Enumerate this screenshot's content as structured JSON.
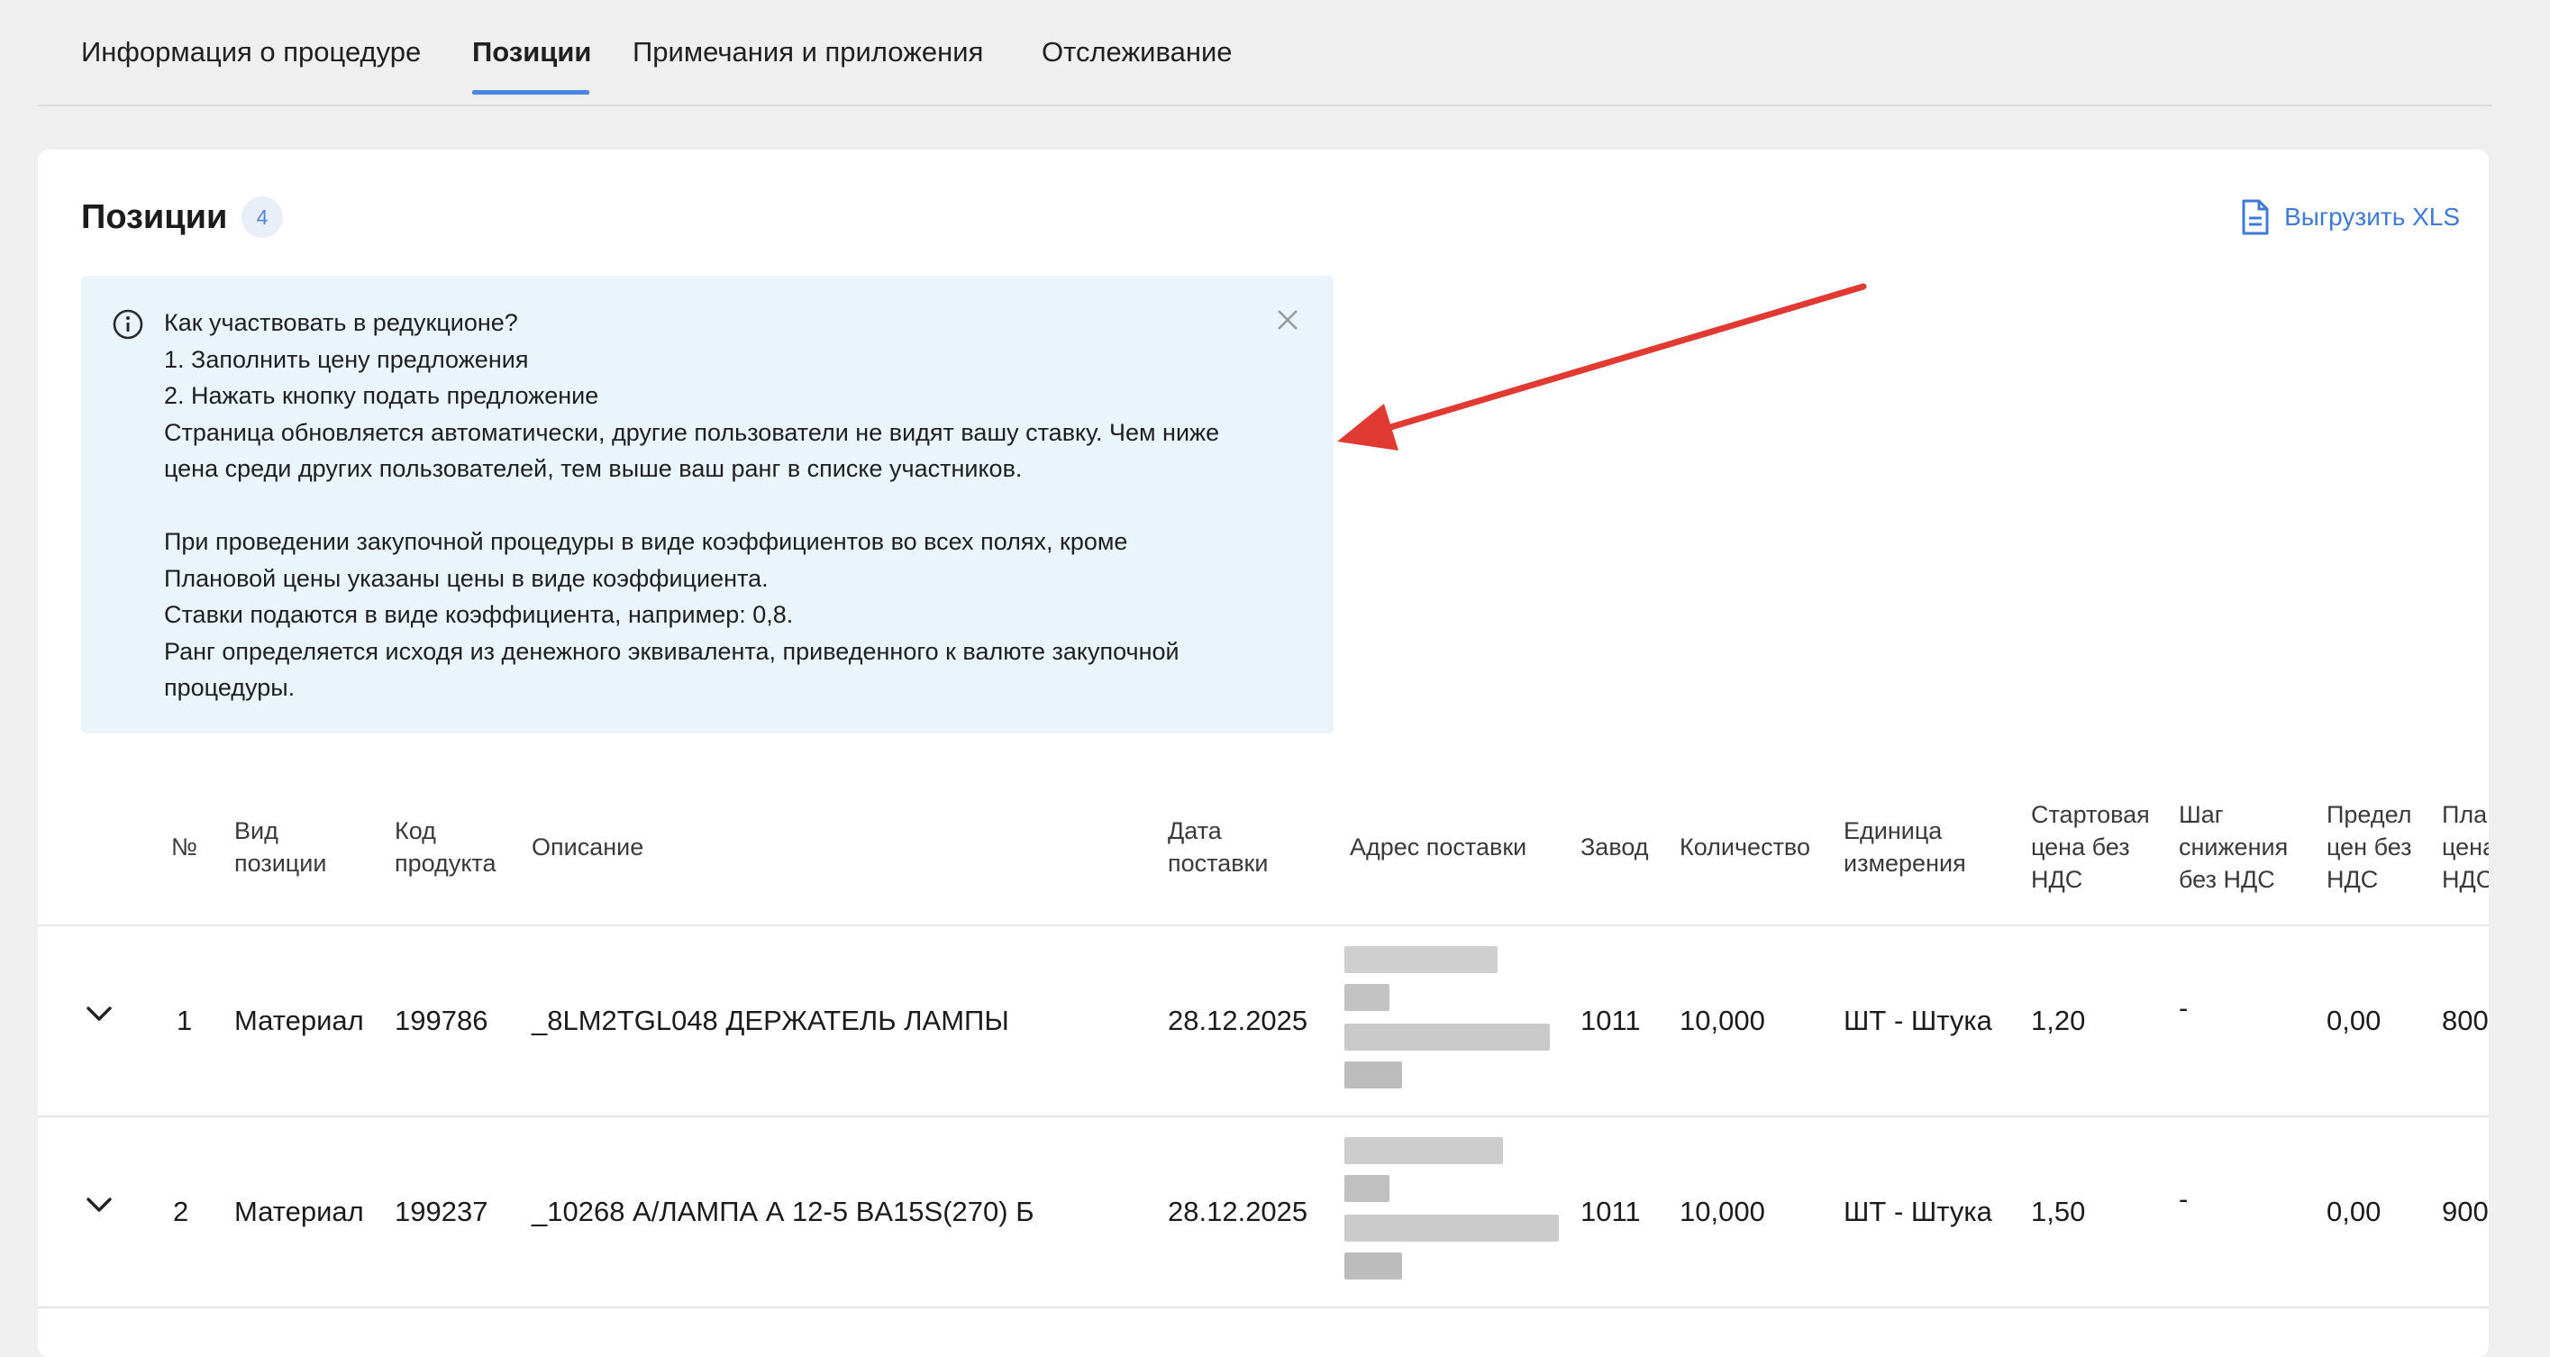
{
  "tabs": [
    {
      "label": "Информация о процедуре",
      "active": false
    },
    {
      "label": "Позиции",
      "active": true
    },
    {
      "label": "Примечания и приложения",
      "active": false
    },
    {
      "label": "Отслеживание",
      "active": false
    }
  ],
  "section": {
    "title": "Позиции",
    "count": "4",
    "export_label": "Выгрузить XLS"
  },
  "info": {
    "lines": [
      "Как участвовать в редукционе?",
      "1. Заполнить цену предложения",
      "2. Нажать кнопку подать предложение",
      "Страница обновляется автоматически, другие пользователи не видят вашу ставку. Чем ниже",
      "цена среди других пользователей, тем выше ваш ранг в списке участников.",
      "",
      "При проведении закупочной процедуры в виде коэффициентов во всех полях, кроме",
      "Плановой цены указаны цены в виде коэффициента.",
      "Ставки подаются в виде коэффициента, например: 0,8.",
      "Ранг определяется исходя из денежного эквивалента, приведенного к валюте закупочной",
      "процедуры."
    ]
  },
  "table": {
    "headers": {
      "num": "№",
      "type": "Вид позиции",
      "code": "Код продукта",
      "desc": "Описание",
      "date": "Дата поставки",
      "address": "Адрес поставки",
      "plant": "Завод",
      "qty": "Количество",
      "unit": "Единица измерения",
      "start_price": "Стартовая цена без НДС",
      "step": "Шаг снижения без НДС",
      "limit": "Предел цен без НДС",
      "plan": "Плановая цена без НДС"
    },
    "rows": [
      {
        "num": "1",
        "type": "Материал",
        "code": "199786",
        "desc": "_8LM2TGL048 ДЕРЖАТЕЛЬ ЛАМПЫ",
        "date": "28.12.2025",
        "plant": "1011",
        "qty": "10,000",
        "unit": "ШТ - Штука",
        "start_price": "1,20",
        "step": "-",
        "limit": "0,00",
        "plan": "800"
      },
      {
        "num": "2",
        "type": "Материал",
        "code": "199237",
        "desc": "_10268 А/ЛАМПА А 12-5 BA15S(270) Б",
        "date": "28.12.2025",
        "plant": "1011",
        "qty": "10,000",
        "unit": "ШТ - Штука",
        "start_price": "1,50",
        "step": "-",
        "limit": "0,00",
        "plan": "900"
      }
    ]
  },
  "colors": {
    "accent": "#4d86e0",
    "info_bg": "#eaf4fb",
    "arrow": "#e03a33"
  },
  "icons": {
    "info": "info-circle-icon",
    "close": "close-icon",
    "export": "document-icon",
    "expand": "chevron-down-icon",
    "annotation": "red-arrow-annotation"
  }
}
